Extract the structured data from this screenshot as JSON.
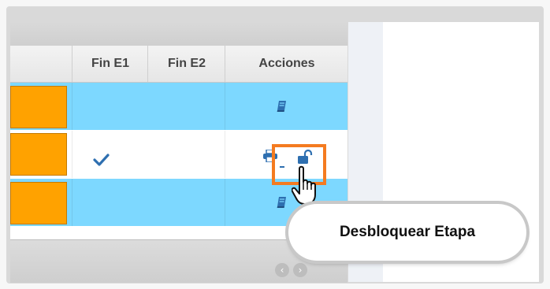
{
  "grid": {
    "columns": [
      {
        "label": ""
      },
      {
        "label": "Fin E1"
      },
      {
        "label": "Fin E2"
      },
      {
        "label": "Acciones"
      }
    ],
    "rows": [
      {
        "fin_e1_checked": false,
        "actions": [
          "book-icon"
        ]
      },
      {
        "fin_e1_checked": true,
        "actions": [
          "print-icon",
          "unlock-icon"
        ]
      },
      {
        "fin_e1_checked": false,
        "actions": [
          "book-icon"
        ]
      }
    ]
  },
  "tooltip": {
    "text": "Desbloquear Etapa"
  },
  "colors": {
    "row_blue": "#7dd8ff",
    "status_orange": "#ffa200",
    "highlight": "#f47b20",
    "icon_blue": "#2e6fb0"
  }
}
